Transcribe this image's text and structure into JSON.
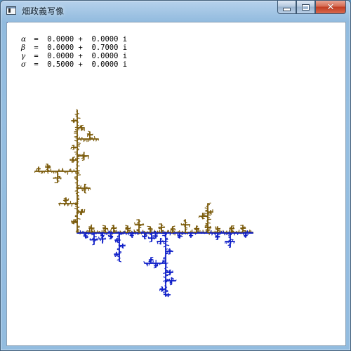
{
  "window": {
    "title": "畑政義写像",
    "buttons": {
      "minimize": "minimize",
      "maximize": "maximize",
      "close": "close"
    }
  },
  "parameters": [
    {
      "symbol": "α",
      "text": " =  0.0000 +  0.0000 i"
    },
    {
      "symbol": "β",
      "text": " =  0.0000 +  0.7000 i"
    },
    {
      "symbol": "γ",
      "text": " =  0.0000 +  0.0000 i"
    },
    {
      "symbol": "σ",
      "text": " =  0.5000 +  0.0000 i"
    }
  ],
  "colors": {
    "upper_branch": "#7a5a0a",
    "lower_branch": "#1020c8",
    "background": "#ffffff"
  },
  "icons": {
    "app": "app-window-icon",
    "minimize": "minimize-icon",
    "maximize": "maximize-icon",
    "close": "close-icon"
  }
}
